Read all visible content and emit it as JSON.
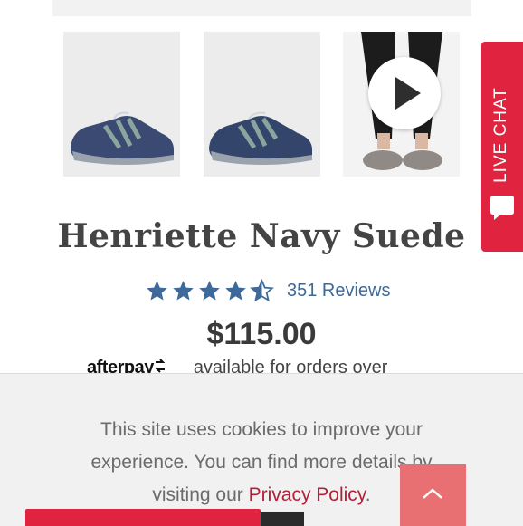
{
  "product": {
    "title": "Henriette Navy Suede",
    "rating": 4.5,
    "reviews_label": "351 Reviews",
    "price": "$115.00"
  },
  "afterpay": {
    "logo": "afterpay",
    "text": "available for orders over"
  },
  "gallery": {
    "items": [
      {
        "kind": "image",
        "subject": "shoe-side-view"
      },
      {
        "kind": "image",
        "subject": "shoe-side-view"
      },
      {
        "kind": "video",
        "subject": "model-wearing-shoes"
      }
    ]
  },
  "live_chat": {
    "label": "LIVE CHAT"
  },
  "cookie_banner": {
    "text": "This site uses cookies to improve your experience. You can find more details by visiting our ",
    "link_label": "Privacy Policy",
    "suffix": "."
  },
  "colors": {
    "accent_red": "#e0243f",
    "star_blue": "#3d6a9b",
    "link_red": "#b3203a"
  }
}
